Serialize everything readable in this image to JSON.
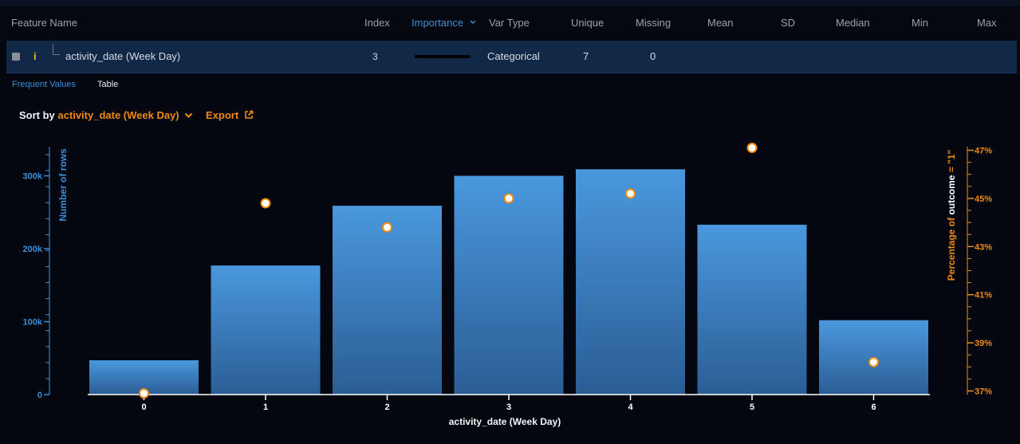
{
  "table": {
    "headers": {
      "feature_name": "Feature Name",
      "index": "Index",
      "importance": "Importance",
      "var_type": "Var Type",
      "unique": "Unique",
      "missing": "Missing",
      "mean": "Mean",
      "sd": "SD",
      "median": "Median",
      "min": "Min",
      "max": "Max"
    },
    "sort_indicator_icon": "chevron-down-icon",
    "row": {
      "name": "activity_date (Week Day)",
      "info_icon_glyph": "i",
      "index": "3",
      "importance_fraction": 0.95,
      "var_type": "Categorical",
      "unique": "7",
      "missing": "0"
    }
  },
  "tabs": {
    "frequent_values": "Frequent Values",
    "table": "Table",
    "active": "frequent_values"
  },
  "controls": {
    "sort_by_label": "Sort by",
    "sort_by_value": "activity_date (Week Day)",
    "export_label": "Export"
  },
  "colors": {
    "accent_blue": "#3b8fd8",
    "accent_orange": "#ef8a16",
    "bar_top": "#4a98de",
    "bar_bottom": "#2b5d94",
    "row_bg": "#112846",
    "info_yellow": "#f3c21b"
  },
  "chart_data": {
    "type": "bar",
    "categories": [
      "0",
      "1",
      "2",
      "3",
      "4",
      "5",
      "6"
    ],
    "xlabel": "activity_date (Week Day)",
    "ylabel": "Number of rows",
    "y2label": "Percentage of outcome = \"1\"",
    "y2label_parts": {
      "prefix": "Percentage of ",
      "highlight": "outcome",
      "suffix": " = \"1\""
    },
    "ylim": [
      0,
      340000
    ],
    "y_ticks": [
      0,
      100000,
      200000,
      300000
    ],
    "y_tick_labels": [
      "0",
      "100k",
      "200k",
      "300k"
    ],
    "y2lim": [
      36.85,
      47.15
    ],
    "y2_ticks": [
      37,
      39,
      41,
      43,
      45,
      47
    ],
    "y2_tick_labels": [
      "37%",
      "39%",
      "41%",
      "43%",
      "45%",
      "47%"
    ],
    "series": [
      {
        "axis": "left",
        "kind": "bar",
        "values": [
          47000,
          177000,
          259000,
          300000,
          309000,
          233000,
          102000
        ]
      },
      {
        "axis": "right",
        "kind": "point",
        "values": [
          36.9,
          44.8,
          43.8,
          45.0,
          45.2,
          47.1,
          38.2
        ]
      }
    ],
    "grid": false,
    "legend": "none"
  }
}
